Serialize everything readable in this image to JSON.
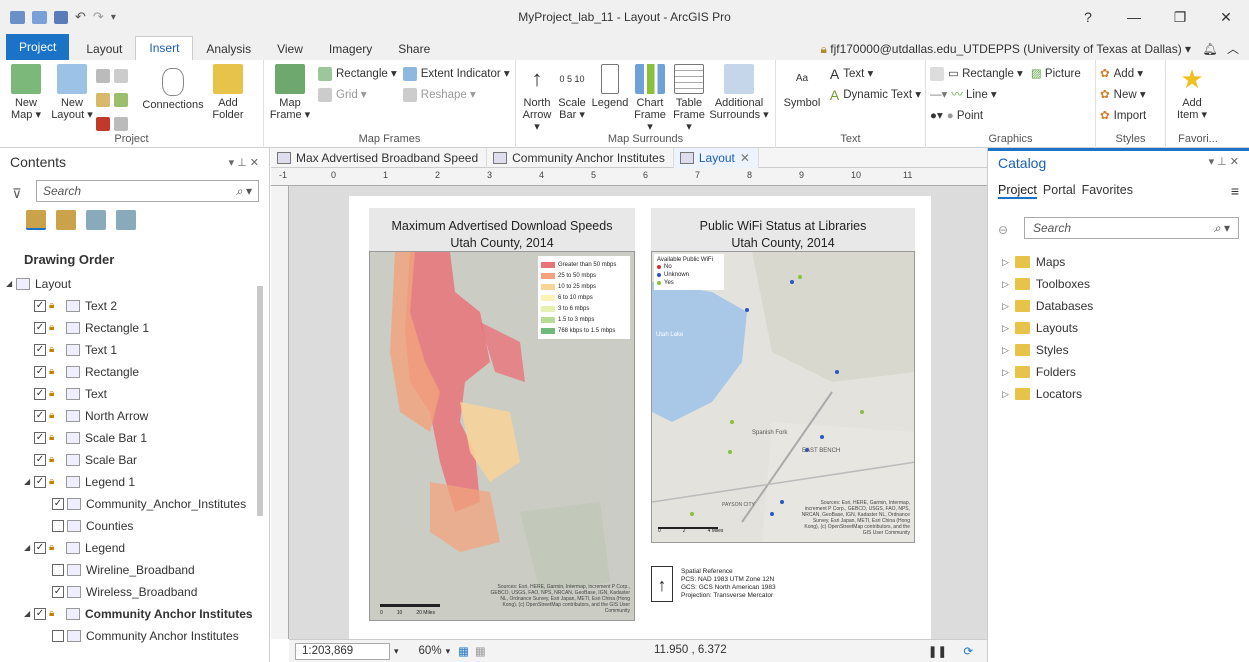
{
  "window": {
    "title": "MyProject_lab_11 - Layout - ArcGIS Pro",
    "help": "?",
    "minimize": "—",
    "restore": "❐",
    "close": "✕"
  },
  "ribbon_tabs": [
    "Project",
    "Layout",
    "Insert",
    "Analysis",
    "View",
    "Imagery",
    "Share"
  ],
  "active_tab": "Insert",
  "user": "fjf170000@utdallas.edu_UTDEPPS (University of Texas at Dallas) ▾",
  "ribbon": {
    "project": {
      "name": "Project",
      "new_map": "New Map ▾",
      "new_layout": "New Layout ▾",
      "connections": "Connections",
      "add_folder": "Add Folder"
    },
    "map_frames": {
      "name": "Map Frames",
      "map_frame": "Map Frame ▾",
      "rectangle": "Rectangle ▾",
      "grid": "Grid ▾",
      "extent_indicator": "Extent Indicator ▾",
      "reshape": "Reshape ▾"
    },
    "map_surrounds": {
      "name": "Map Surrounds",
      "north_arrow": "North Arrow ▾",
      "scale_bar": "Scale Bar ▾",
      "legend": "Legend",
      "chart_frame": "Chart Frame ▾",
      "table_frame": "Table Frame ▾",
      "additional": "Additional Surrounds ▾"
    },
    "text": {
      "name": "Text",
      "symbol": "Symbol",
      "text": "Text ▾",
      "dynamic_text": "Dynamic Text ▾"
    },
    "graphics": {
      "name": "Graphics",
      "rectangle": "Rectangle ▾",
      "line": "Line ▾",
      "point": "Point",
      "picture": "Picture"
    },
    "styles": {
      "name": "Styles",
      "add": "Add ▾",
      "new": "New ▾",
      "import": "Import"
    },
    "favorites": {
      "name": "Favori...",
      "add_item": "Add Item ▾"
    }
  },
  "contents": {
    "title": "Contents",
    "search_placeholder": "Search",
    "drawing_order": "Drawing Order",
    "items": [
      {
        "label": "Layout",
        "level": 0,
        "check": false,
        "bold": false
      },
      {
        "label": "Text 2",
        "level": 1,
        "check": true,
        "bold": false
      },
      {
        "label": "Rectangle 1",
        "level": 1,
        "check": true,
        "bold": false
      },
      {
        "label": "Text 1",
        "level": 1,
        "check": true,
        "bold": false
      },
      {
        "label": "Rectangle",
        "level": 1,
        "check": true,
        "bold": false
      },
      {
        "label": "Text",
        "level": 1,
        "check": true,
        "bold": false
      },
      {
        "label": "North Arrow",
        "level": 1,
        "check": true,
        "bold": false
      },
      {
        "label": "Scale Bar 1",
        "level": 1,
        "check": true,
        "bold": false
      },
      {
        "label": "Scale Bar",
        "level": 1,
        "check": true,
        "bold": false
      },
      {
        "label": "Legend 1",
        "level": 1,
        "check": true,
        "bold": false
      },
      {
        "label": "Community_Anchor_Institutes",
        "level": 2,
        "check": true,
        "bold": false
      },
      {
        "label": "Counties",
        "level": 2,
        "check": false,
        "bold": false
      },
      {
        "label": "Legend",
        "level": 1,
        "check": true,
        "bold": false
      },
      {
        "label": "Wireline_Broadband",
        "level": 2,
        "check": false,
        "bold": false
      },
      {
        "label": "Wireless_Broadband",
        "level": 2,
        "check": true,
        "bold": false
      },
      {
        "label": "Community Anchor Institutes",
        "level": 1,
        "check": true,
        "bold": true
      },
      {
        "label": "Community Anchor Institutes",
        "level": 2,
        "check": false,
        "bold": false
      }
    ]
  },
  "doc_tabs": [
    "Max Advertised Broadband Speed",
    "Community Anchor Institutes",
    "Layout"
  ],
  "ruler_labels": [
    "-1",
    "0",
    "1",
    "2",
    "3",
    "4",
    "5",
    "6",
    "7",
    "8",
    "9",
    "10",
    "11"
  ],
  "layout": {
    "map1": {
      "title_line1": "Maximum Advertised Download Speeds",
      "title_line2": "Utah County, 2014",
      "legend": [
        {
          "label": "Greater than 50 mbps",
          "color": "#e8737a"
        },
        {
          "label": "25 to 50 mbps",
          "color": "#f2a37d"
        },
        {
          "label": "10 to 25 mbps",
          "color": "#f9d49a"
        },
        {
          "label": "6 to 10 mbps",
          "color": "#fbf2b8"
        },
        {
          "label": "3 to 6 mbps",
          "color": "#e6f0b0"
        },
        {
          "label": "1.5 to 3 mbps",
          "color": "#b9dc97"
        },
        {
          "label": "768 kbps to 1.5 mbps",
          "color": "#6fba7a"
        }
      ],
      "attribution": "Sources: Esri, HERE, Garmin, Intermap, increment P Corp., GEBCO, USGS, FAO, NPS, NRCAN, GeoBase, IGN, Kadaster NL, Ordnance Survey, Esri Japan, METI, Esri China (Hong Kong), (c) OpenStreetMap contributors, and the GIS User Community",
      "scale_labels": [
        "0",
        "10",
        "20 Miles"
      ]
    },
    "map2": {
      "title_line1": "Public WiFi Status at Libraries",
      "title_line2": "Utah County, 2014",
      "legend_title": "Available Public WiFi",
      "legend": [
        {
          "label": "No",
          "color": "#d63030"
        },
        {
          "label": "Unknown",
          "color": "#2a55c8"
        },
        {
          "label": "Yes",
          "color": "#8ac03a"
        }
      ],
      "place_labels": [
        "Utah Lake",
        "Spanish Fork",
        "EAST BENCH",
        "PAYSON CITY"
      ],
      "attribution": "Sources: Esri, HERE, Garmin, Intermap, increment P Corp., GEBCO, USGS, FAO, NPS, NRCAN, GeoBase, IGN, Kadaster NL, Ordnance Survey, Esri Japan, METI, Esri China (Hong Kong), (c) OpenStreetMap contributors, and the GIS User Community",
      "scale_labels": [
        "0",
        "2",
        "4 Miles"
      ]
    },
    "spatial_reference": [
      "Spatial Reference",
      "PCS: NAD 1983 UTM Zone 12N",
      "GCS: GCS North American 1983",
      "Projection: Transverse Mercator"
    ]
  },
  "catalog": {
    "title": "Catalog",
    "tabs": [
      "Project",
      "Portal",
      "Favorites"
    ],
    "search_placeholder": "Search",
    "items": [
      "Maps",
      "Toolboxes",
      "Databases",
      "Layouts",
      "Styles",
      "Folders",
      "Locators"
    ]
  },
  "status": {
    "scale": "1:203,869",
    "zoom": "60%",
    "coords": "11.950 , 6.372"
  }
}
